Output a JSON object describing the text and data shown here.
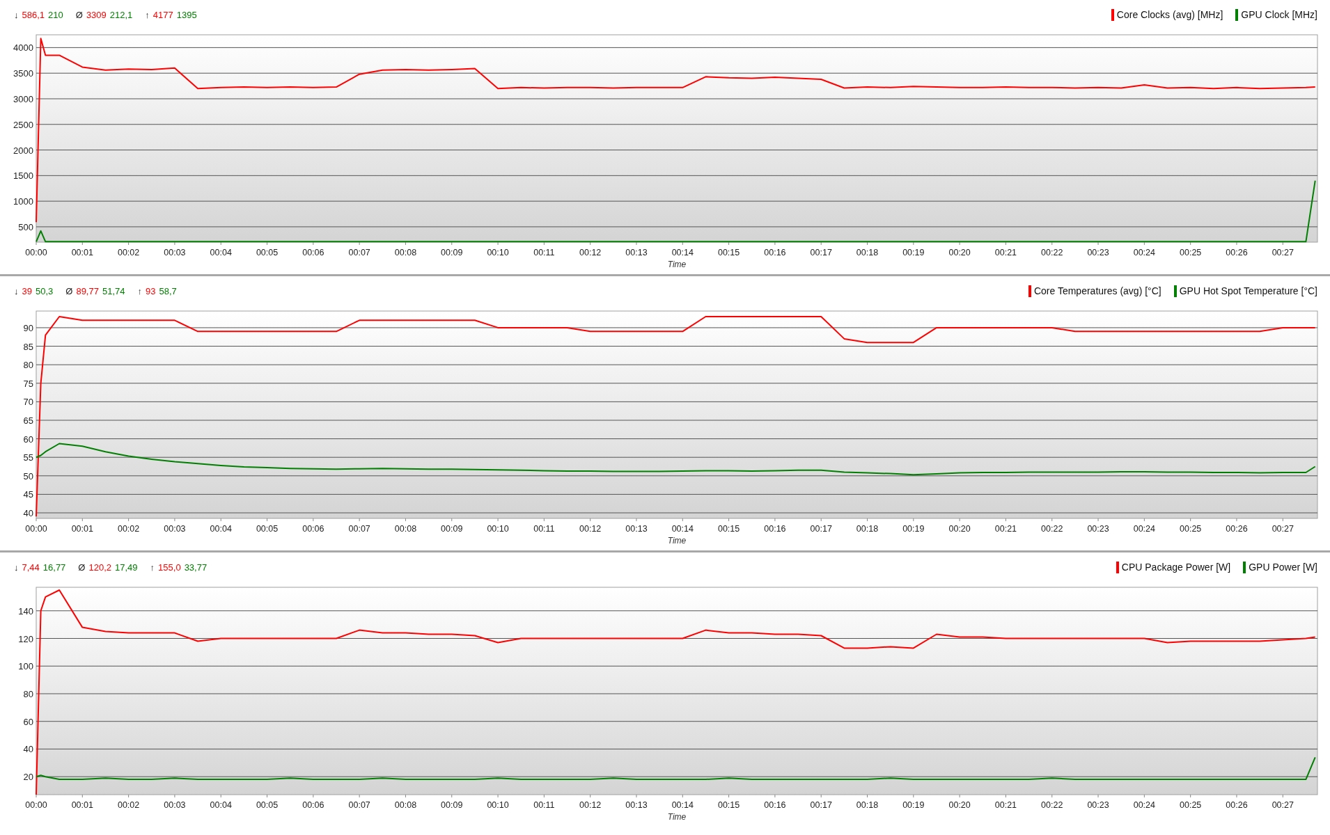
{
  "panels": [
    {
      "stats": [
        {
          "symbol": "↓",
          "values": [
            "586,1",
            "210"
          ]
        },
        {
          "symbol": "Ø",
          "values": [
            "3309",
            "212,1"
          ]
        },
        {
          "symbol": "↑",
          "values": [
            "4177",
            "1395"
          ]
        }
      ],
      "chart_data": {
        "type": "line",
        "grid": true,
        "xlabel": "Time",
        "xlim": [
          0,
          27.75
        ],
        "ylim": [
          200,
          4250
        ],
        "yticks": [
          500,
          1000,
          1500,
          2000,
          2500,
          3000,
          3500,
          4000
        ],
        "xticks": [
          {
            "value": 0,
            "label": "00:00"
          },
          {
            "value": 1,
            "label": "00:01"
          },
          {
            "value": 2,
            "label": "00:02"
          },
          {
            "value": 3,
            "label": "00:03"
          },
          {
            "value": 4,
            "label": "00:04"
          },
          {
            "value": 5,
            "label": "00:05"
          },
          {
            "value": 6,
            "label": "00:06"
          },
          {
            "value": 7,
            "label": "00:07"
          },
          {
            "value": 8,
            "label": "00:08"
          },
          {
            "value": 9,
            "label": "00:09"
          },
          {
            "value": 10,
            "label": "00:10"
          },
          {
            "value": 11,
            "label": "00:11"
          },
          {
            "value": 12,
            "label": "00:12"
          },
          {
            "value": 13,
            "label": "00:13"
          },
          {
            "value": 14,
            "label": "00:14"
          },
          {
            "value": 15,
            "label": "00:15"
          },
          {
            "value": 16,
            "label": "00:16"
          },
          {
            "value": 17,
            "label": "00:17"
          },
          {
            "value": 18,
            "label": "00:18"
          },
          {
            "value": 19,
            "label": "00:19"
          },
          {
            "value": 20,
            "label": "00:20"
          },
          {
            "value": 21,
            "label": "00:21"
          },
          {
            "value": 22,
            "label": "00:22"
          },
          {
            "value": 23,
            "label": "00:23"
          },
          {
            "value": 24,
            "label": "00:24"
          },
          {
            "value": 25,
            "label": "00:25"
          },
          {
            "value": 26,
            "label": "00:26"
          },
          {
            "value": 27,
            "label": "00:27"
          }
        ],
        "x": [
          0,
          0.1,
          0.2,
          0.5,
          1,
          1.5,
          2,
          2.5,
          3,
          3.5,
          4,
          4.5,
          5,
          5.5,
          6,
          6.5,
          7,
          7.5,
          8,
          8.5,
          9,
          9.5,
          10,
          10.5,
          11,
          11.5,
          12,
          12.5,
          13,
          13.5,
          14,
          14.5,
          15,
          15.5,
          16,
          16.5,
          17,
          17.5,
          18,
          18.5,
          19,
          19.5,
          20,
          20.5,
          21,
          21.5,
          22,
          22.5,
          23,
          23.5,
          24,
          24.5,
          25,
          25.5,
          26,
          26.5,
          27,
          27.5,
          27.7
        ],
        "series": [
          {
            "name": "Core Clocks (avg) [MHz]",
            "color": "#ff0000",
            "values": [
              590,
              4180,
              3850,
              3850,
              3620,
              3560,
              3580,
              3570,
              3600,
              3200,
              3220,
              3230,
              3220,
              3230,
              3220,
              3230,
              3480,
              3560,
              3570,
              3560,
              3570,
              3590,
              3200,
              3220,
              3210,
              3220,
              3220,
              3210,
              3220,
              3220,
              3220,
              3430,
              3410,
              3400,
              3420,
              3400,
              3380,
              3210,
              3230,
              3220,
              3240,
              3230,
              3220,
              3220,
              3230,
              3220,
              3220,
              3210,
              3220,
              3210,
              3270,
              3210,
              3220,
              3200,
              3220,
              3200,
              3210,
              3220,
              3230
            ]
          },
          {
            "name": "GPU Clock [MHz]",
            "color": "#008000",
            "values": [
              210,
              420,
              210,
              210,
              210,
              210,
              210,
              210,
              210,
              210,
              210,
              210,
              210,
              210,
              210,
              210,
              210,
              210,
              210,
              210,
              210,
              210,
              210,
              210,
              210,
              210,
              210,
              210,
              210,
              210,
              210,
              210,
              210,
              210,
              210,
              210,
              210,
              210,
              210,
              210,
              210,
              210,
              210,
              210,
              210,
              210,
              210,
              210,
              210,
              210,
              210,
              210,
              210,
              210,
              210,
              210,
              210,
              210,
              1400
            ]
          }
        ]
      }
    },
    {
      "stats": [
        {
          "symbol": "↓",
          "values": [
            "39",
            "50,3"
          ]
        },
        {
          "symbol": "Ø",
          "values": [
            "89,77",
            "51,74"
          ]
        },
        {
          "symbol": "↑",
          "values": [
            "93",
            "58,7"
          ]
        }
      ],
      "chart_data": {
        "type": "line",
        "grid": true,
        "xlabel": "Time",
        "xlim": [
          0,
          27.75
        ],
        "ylim": [
          38.5,
          94.5
        ],
        "yticks": [
          40,
          45,
          50,
          55,
          60,
          65,
          70,
          75,
          80,
          85,
          90
        ],
        "xticks": [
          {
            "value": 0,
            "label": "00:00"
          },
          {
            "value": 1,
            "label": "00:01"
          },
          {
            "value": 2,
            "label": "00:02"
          },
          {
            "value": 3,
            "label": "00:03"
          },
          {
            "value": 4,
            "label": "00:04"
          },
          {
            "value": 5,
            "label": "00:05"
          },
          {
            "value": 6,
            "label": "00:06"
          },
          {
            "value": 7,
            "label": "00:07"
          },
          {
            "value": 8,
            "label": "00:08"
          },
          {
            "value": 9,
            "label": "00:09"
          },
          {
            "value": 10,
            "label": "00:10"
          },
          {
            "value": 11,
            "label": "00:11"
          },
          {
            "value": 12,
            "label": "00:12"
          },
          {
            "value": 13,
            "label": "00:13"
          },
          {
            "value": 14,
            "label": "00:14"
          },
          {
            "value": 15,
            "label": "00:15"
          },
          {
            "value": 16,
            "label": "00:16"
          },
          {
            "value": 17,
            "label": "00:17"
          },
          {
            "value": 18,
            "label": "00:18"
          },
          {
            "value": 19,
            "label": "00:19"
          },
          {
            "value": 20,
            "label": "00:20"
          },
          {
            "value": 21,
            "label": "00:21"
          },
          {
            "value": 22,
            "label": "00:22"
          },
          {
            "value": 23,
            "label": "00:23"
          },
          {
            "value": 24,
            "label": "00:24"
          },
          {
            "value": 25,
            "label": "00:25"
          },
          {
            "value": 26,
            "label": "00:26"
          },
          {
            "value": 27,
            "label": "00:27"
          }
        ],
        "x": [
          0,
          0.1,
          0.2,
          0.5,
          1,
          1.5,
          2,
          2.5,
          3,
          3.5,
          4,
          4.5,
          5,
          5.5,
          6,
          6.5,
          7,
          7.5,
          8,
          8.5,
          9,
          9.5,
          10,
          10.5,
          11,
          11.5,
          12,
          12.5,
          13,
          13.5,
          14,
          14.5,
          15,
          15.5,
          16,
          16.5,
          17,
          17.5,
          18,
          18.5,
          19,
          19.5,
          20,
          20.5,
          21,
          21.5,
          22,
          22.5,
          23,
          23.5,
          24,
          24.5,
          25,
          25.5,
          26,
          26.5,
          27,
          27.5,
          27.7
        ],
        "series": [
          {
            "name": "Core Temperatures (avg) [°C]",
            "color": "#ff0000",
            "values": [
              39,
              75,
              88,
              93,
              92,
              92,
              92,
              92,
              92,
              89,
              89,
              89,
              89,
              89,
              89,
              89,
              92,
              92,
              92,
              92,
              92,
              92,
              90,
              90,
              90,
              90,
              89,
              89,
              89,
              89,
              89,
              93,
              93,
              93,
              93,
              93,
              93,
              87,
              86,
              86,
              86,
              90,
              90,
              90,
              90,
              90,
              90,
              89,
              89,
              89,
              89,
              89,
              89,
              89,
              89,
              89,
              90,
              90,
              90
            ]
          },
          {
            "name": "GPU Hot Spot Temperature [°C]",
            "color": "#008000",
            "values": [
              55,
              55.5,
              56.5,
              58.7,
              58,
              56.5,
              55.3,
              54.5,
              53.8,
              53.3,
              52.8,
              52.4,
              52.2,
              52,
              51.9,
              51.8,
              51.9,
              52,
              51.9,
              51.8,
              51.8,
              51.7,
              51.6,
              51.5,
              51.4,
              51.3,
              51.3,
              51.2,
              51.2,
              51.2,
              51.3,
              51.4,
              51.4,
              51.3,
              51.4,
              51.5,
              51.5,
              51,
              50.8,
              50.6,
              50.3,
              50.5,
              50.8,
              50.9,
              50.9,
              51,
              51,
              51,
              51,
              51.1,
              51.1,
              51,
              51,
              50.9,
              50.9,
              50.8,
              50.9,
              50.9,
              52.5
            ]
          }
        ]
      }
    },
    {
      "stats": [
        {
          "symbol": "↓",
          "values": [
            "7,44",
            "16,77"
          ]
        },
        {
          "symbol": "Ø",
          "values": [
            "120,2",
            "17,49"
          ]
        },
        {
          "symbol": "↑",
          "values": [
            "155,0",
            "33,77"
          ]
        }
      ],
      "chart_data": {
        "type": "line",
        "grid": true,
        "xlabel": "Time",
        "xlim": [
          0,
          27.75
        ],
        "ylim": [
          7,
          157
        ],
        "yticks": [
          20,
          40,
          60,
          80,
          100,
          120,
          140
        ],
        "xticks": [
          {
            "value": 0,
            "label": "00:00"
          },
          {
            "value": 1,
            "label": "00:01"
          },
          {
            "value": 2,
            "label": "00:02"
          },
          {
            "value": 3,
            "label": "00:03"
          },
          {
            "value": 4,
            "label": "00:04"
          },
          {
            "value": 5,
            "label": "00:05"
          },
          {
            "value": 6,
            "label": "00:06"
          },
          {
            "value": 7,
            "label": "00:07"
          },
          {
            "value": 8,
            "label": "00:08"
          },
          {
            "value": 9,
            "label": "00:09"
          },
          {
            "value": 10,
            "label": "00:10"
          },
          {
            "value": 11,
            "label": "00:11"
          },
          {
            "value": 12,
            "label": "00:12"
          },
          {
            "value": 13,
            "label": "00:13"
          },
          {
            "value": 14,
            "label": "00:14"
          },
          {
            "value": 15,
            "label": "00:15"
          },
          {
            "value": 16,
            "label": "00:16"
          },
          {
            "value": 17,
            "label": "00:17"
          },
          {
            "value": 18,
            "label": "00:18"
          },
          {
            "value": 19,
            "label": "00:19"
          },
          {
            "value": 20,
            "label": "00:20"
          },
          {
            "value": 21,
            "label": "00:21"
          },
          {
            "value": 22,
            "label": "00:22"
          },
          {
            "value": 23,
            "label": "00:23"
          },
          {
            "value": 24,
            "label": "00:24"
          },
          {
            "value": 25,
            "label": "00:25"
          },
          {
            "value": 26,
            "label": "00:26"
          },
          {
            "value": 27,
            "label": "00:27"
          }
        ],
        "x": [
          0,
          0.1,
          0.2,
          0.5,
          1,
          1.5,
          2,
          2.5,
          3,
          3.5,
          4,
          4.5,
          5,
          5.5,
          6,
          6.5,
          7,
          7.5,
          8,
          8.5,
          9,
          9.5,
          10,
          10.5,
          11,
          11.5,
          12,
          12.5,
          13,
          13.5,
          14,
          14.5,
          15,
          15.5,
          16,
          16.5,
          17,
          17.5,
          18,
          18.5,
          19,
          19.5,
          20,
          20.5,
          21,
          21.5,
          22,
          22.5,
          23,
          23.5,
          24,
          24.5,
          25,
          25.5,
          26,
          26.5,
          27,
          27.5,
          27.7
        ],
        "series": [
          {
            "name": "CPU Package Power [W]",
            "color": "#ff0000",
            "values": [
              7,
              140,
              150,
              155,
              128,
              125,
              124,
              124,
              124,
              118,
              120,
              120,
              120,
              120,
              120,
              120,
              126,
              124,
              124,
              123,
              123,
              122,
              117,
              120,
              120,
              120,
              120,
              120,
              120,
              120,
              120,
              126,
              124,
              124,
              123,
              123,
              122,
              113,
              113,
              114,
              113,
              123,
              121,
              121,
              120,
              120,
              120,
              120,
              120,
              120,
              120,
              117,
              118,
              118,
              118,
              118,
              119,
              120,
              121
            ]
          },
          {
            "name": "GPU Power [W]",
            "color": "#008000",
            "values": [
              20,
              21,
              20,
              18,
              18,
              19,
              18,
              18,
              19,
              18,
              18,
              18,
              18,
              19,
              18,
              18,
              18,
              19,
              18,
              18,
              18,
              18,
              19,
              18,
              18,
              18,
              18,
              19,
              18,
              18,
              18,
              18,
              19,
              18,
              18,
              18,
              18,
              18,
              18,
              19,
              18,
              18,
              18,
              18,
              18,
              18,
              19,
              18,
              18,
              18,
              18,
              18,
              18,
              18,
              18,
              18,
              18,
              18,
              34
            ]
          }
        ]
      }
    }
  ]
}
